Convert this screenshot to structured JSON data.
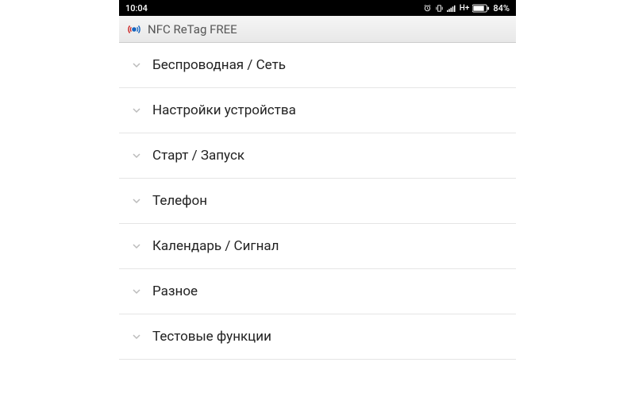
{
  "status_bar": {
    "time": "10:04",
    "battery_text": "84%"
  },
  "header": {
    "title": "NFC ReTag FREE"
  },
  "categories": [
    {
      "label": "Беспроводная / Сеть"
    },
    {
      "label": "Настройки устройства"
    },
    {
      "label": "Старт / Запуск"
    },
    {
      "label": "Телефон"
    },
    {
      "label": "Календарь / Сигнал"
    },
    {
      "label": "Разное"
    },
    {
      "label": "Тестовые функции"
    }
  ]
}
